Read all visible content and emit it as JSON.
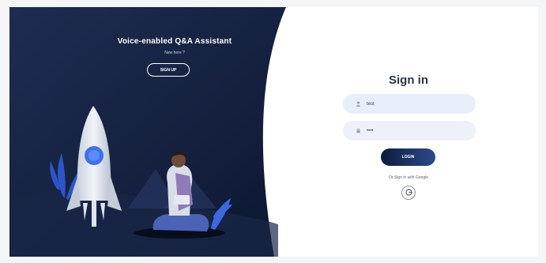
{
  "hero": {
    "title": "Voice-enabled Q&A Assistant",
    "subtitle": "New here ?",
    "signup_label": "SIGN UP"
  },
  "form": {
    "title": "Sign in",
    "username_value": "test",
    "password_value": "••••",
    "login_label": "LOGIN",
    "alt_text": "Or Sign in with Google",
    "google_icon": "google-icon"
  },
  "colors": {
    "hero_dark": "#0b1730",
    "hero_mid": "#1f2c52",
    "accent_blue": "#2c4a8a",
    "field_bg": "#eef1f7",
    "title_text": "#2c3442"
  }
}
